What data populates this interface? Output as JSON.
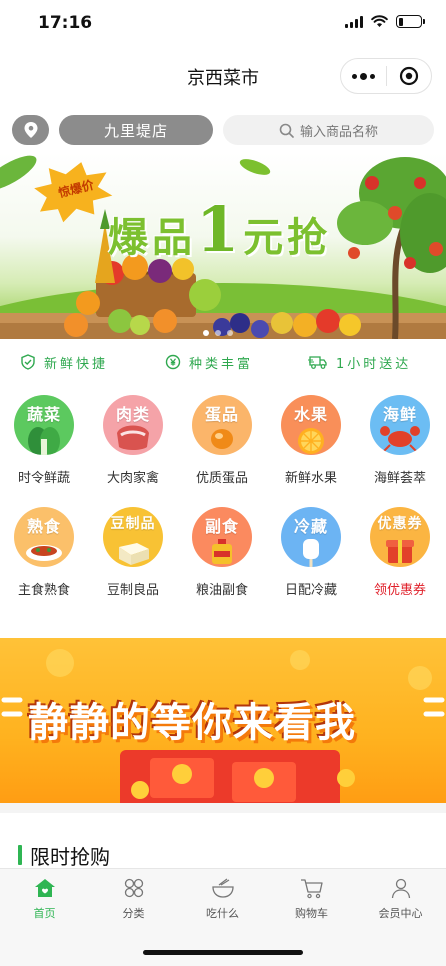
{
  "status_bar": {
    "time": "17:16"
  },
  "nav": {
    "title": "京西菜市"
  },
  "search_row": {
    "store_name": "九里堤店",
    "search_placeholder": "输入商品名称"
  },
  "banner": {
    "tag": "惊爆价",
    "headline_prefix": "爆品",
    "headline_number": "1",
    "headline_suffix": "元抢"
  },
  "features": [
    {
      "icon": "shield-check-icon",
      "label": "新鲜快捷"
    },
    {
      "icon": "yuan-coin-icon",
      "label": "种类丰富"
    },
    {
      "icon": "delivery-truck-icon",
      "label": "1小时送达"
    }
  ],
  "categories": [
    {
      "word": "蔬菜",
      "label": "时令鲜蔬",
      "color": "#5cc95f"
    },
    {
      "word": "肉类",
      "label": "大肉家禽",
      "color": "#f5a3a8"
    },
    {
      "word": "蛋品",
      "label": "优质蛋品",
      "color": "#fbb56a"
    },
    {
      "word": "水果",
      "label": "新鲜水果",
      "color": "#f98f59"
    },
    {
      "word": "海鲜",
      "label": "海鲜荟萃",
      "color": "#6cbdf3"
    },
    {
      "word": "熟食",
      "label": "主食熟食",
      "color": "#fbc06a"
    },
    {
      "word": "豆制品",
      "label": "豆制良品",
      "color": "#f8c234"
    },
    {
      "word": "副食",
      "label": "粮油副食",
      "color": "#fb8a5f"
    },
    {
      "word": "冷藏",
      "label": "日配冷藏",
      "color": "#6cb4f3"
    },
    {
      "word": "优惠券",
      "label": "领优惠券",
      "color": "#fbb542"
    }
  ],
  "promo": {
    "text": "静静的等你来看我"
  },
  "section": {
    "title": "限时抢购"
  },
  "tabs": [
    {
      "icon": "home-icon",
      "label": "首页",
      "active": true
    },
    {
      "icon": "category-icon",
      "label": "分类",
      "active": false
    },
    {
      "icon": "bowl-icon",
      "label": "吃什么",
      "active": false
    },
    {
      "icon": "cart-icon",
      "label": "购物车",
      "active": false
    },
    {
      "icon": "user-icon",
      "label": "会员中心",
      "active": false
    }
  ],
  "colors": {
    "brand_green": "#2fb553",
    "coupon_red": "#e0202a",
    "pill_gray": "#8c8c8c"
  }
}
